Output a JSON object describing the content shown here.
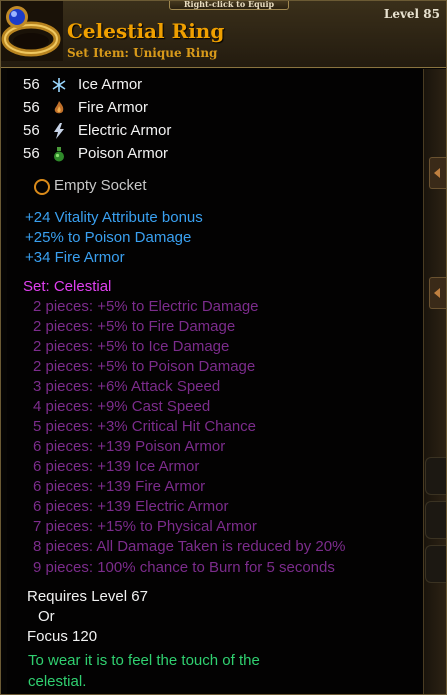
{
  "header": {
    "hint": "Right-click to Equip",
    "name": "Celestial Ring",
    "type": "Set Item: Unique Ring",
    "level": "Level 85",
    "icon": "ring-icon"
  },
  "armor": [
    {
      "value": "56",
      "label": "Ice Armor",
      "icon": "snowflake-icon"
    },
    {
      "value": "56",
      "label": "Fire Armor",
      "icon": "flame-icon"
    },
    {
      "value": "56",
      "label": "Electric Armor",
      "icon": "lightning-icon"
    },
    {
      "value": "56",
      "label": "Poison Armor",
      "icon": "poison-flask-icon"
    }
  ],
  "socket": {
    "label": "Empty Socket",
    "icon": "socket-ring-icon"
  },
  "bonuses": [
    "+24 Vitality Attribute bonus",
    "+25% to Poison Damage",
    "+34 Fire Armor"
  ],
  "set": {
    "title": "Set: Celestial",
    "lines": [
      "2 pieces: +5% to Electric Damage",
      "2 pieces: +5% to Fire Damage",
      "2 pieces: +5% to Ice Damage",
      "2 pieces: +5% to Poison Damage",
      "3 pieces: +6% Attack Speed",
      "4 pieces: +9% Cast Speed",
      "5 pieces: +3% Critical Hit Chance",
      "6 pieces: +139 Poison Armor",
      "6 pieces: +139 Ice Armor",
      "6 pieces: +139 Fire Armor",
      "6 pieces: +139 Electric Armor",
      "7 pieces: +15% to Physical Armor",
      "8 pieces: All Damage Taken is reduced by 20%",
      "9 pieces: 100% chance to Burn for 5 seconds"
    ]
  },
  "requirements": {
    "level": "Requires Level 67",
    "or": "Or",
    "focus": "Focus 120"
  },
  "flavor": {
    "line1": "To wear it is to feel the touch of the",
    "line2": "celestial."
  },
  "colors": {
    "name": "#f0a000",
    "magic": "#3aa0f0",
    "set_title": "#e040f0",
    "set_inactive": "#7c2c8c",
    "flavor": "#30d070"
  }
}
